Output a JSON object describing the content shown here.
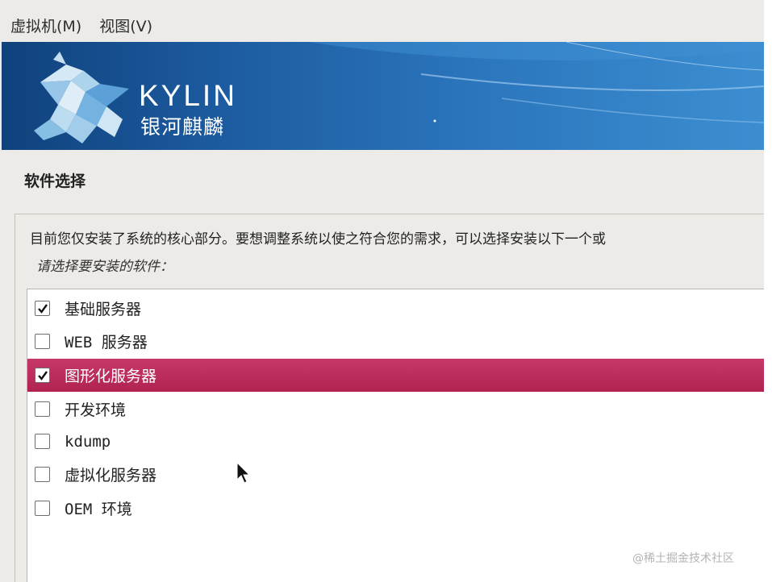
{
  "menubar": {
    "items": [
      {
        "label": "虚拟机(M)"
      },
      {
        "label": "视图(V)"
      }
    ]
  },
  "banner": {
    "logo_text": "KYLIN",
    "logo_subtext": "银河麒麟"
  },
  "section": {
    "title": "软件选择",
    "description": "目前您仅安装了系统的核心部分。要想调整系统以使之符合您的需求，可以选择安装以下一个或",
    "prompt": "请选择要安装的软件："
  },
  "software_list": [
    {
      "label": "基础服务器",
      "checked": true,
      "selected": false
    },
    {
      "label": "WEB 服务器",
      "checked": false,
      "selected": false
    },
    {
      "label": "图形化服务器",
      "checked": true,
      "selected": true
    },
    {
      "label": "开发环境",
      "checked": false,
      "selected": false
    },
    {
      "label": "kdump",
      "checked": false,
      "selected": false
    },
    {
      "label": "虚拟化服务器",
      "checked": false,
      "selected": false
    },
    {
      "label": "OEM 环境",
      "checked": false,
      "selected": false
    }
  ],
  "watermark": "@稀土掘金技术社区",
  "colors": {
    "selection": "#b8295a",
    "banner": "#1d5ca1"
  }
}
